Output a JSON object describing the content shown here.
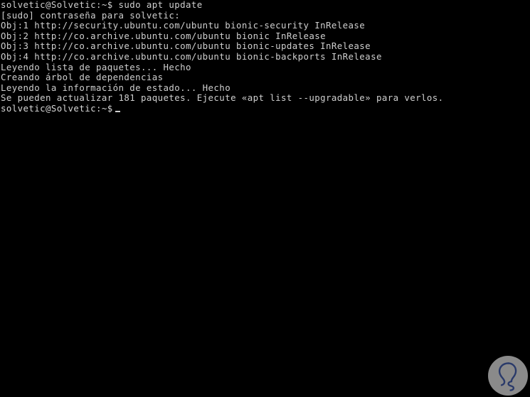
{
  "terminal": {
    "shell_prompt": "solvetic@Solvetic:~$",
    "background_color": "#000000",
    "text_color": "#cfcfcf",
    "lines": [
      {
        "id": "command-line",
        "text": "solvetic@Solvetic:~$ sudo apt update"
      },
      {
        "id": "sudo-password-prompt",
        "text": "[sudo] contraseña para solvetic:"
      },
      {
        "id": "obj-1",
        "text": "Obj:1 http://security.ubuntu.com/ubuntu bionic-security InRelease"
      },
      {
        "id": "obj-2",
        "text": "Obj:2 http://co.archive.ubuntu.com/ubuntu bionic InRelease"
      },
      {
        "id": "obj-3",
        "text": "Obj:3 http://co.archive.ubuntu.com/ubuntu bionic-updates InRelease"
      },
      {
        "id": "obj-4",
        "text": "Obj:4 http://co.archive.ubuntu.com/ubuntu bionic-backports InRelease"
      },
      {
        "id": "reading-package-list",
        "text": "Leyendo lista de paquetes... Hecho"
      },
      {
        "id": "building-dependency-tree",
        "text": "Creando árbol de dependencias"
      },
      {
        "id": "reading-state-info",
        "text": "Leyendo la información de estado... Hecho"
      },
      {
        "id": "upgradable-summary",
        "text": "Se pueden actualizar 181 paquetes. Ejecute «apt list --upgradable» para verlos."
      }
    ],
    "final_prompt": "solvetic@Solvetic:~$",
    "command_entered": "sudo apt update",
    "upgradable_package_count": "181"
  },
  "watermark": {
    "icon_name": "lightbulb-icon",
    "circle_color": "#8a8a8a",
    "stroke_color": "#2a3a6a"
  }
}
